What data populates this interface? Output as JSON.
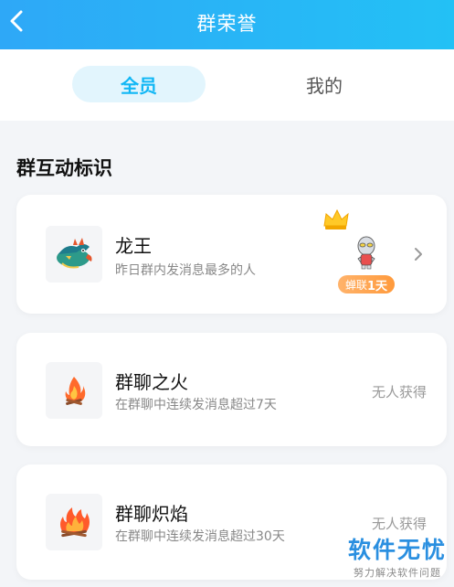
{
  "header": {
    "title": "群荣誉"
  },
  "tabs": [
    {
      "label": "全员",
      "active": true
    },
    {
      "label": "我的",
      "active": false
    }
  ],
  "section": {
    "title": "群互动标识"
  },
  "badges": [
    {
      "name": "龙王",
      "description": "昨日群内发消息最多的人",
      "icon": "dragon-icon",
      "holder_badge": {
        "prefix": "蝉联",
        "days": "1天"
      }
    },
    {
      "name": "群聊之火",
      "description": "在群聊中连续发消息超过7天",
      "icon": "fire-icon",
      "status": "无人获得"
    },
    {
      "name": "群聊炽焰",
      "description": "在群聊中连续发消息超过30天",
      "icon": "blaze-icon",
      "status": "无人获得"
    }
  ],
  "watermark": {
    "brand": "软件无忧",
    "slogan": "努力解决软件问题"
  },
  "colors": {
    "header": "#2ea8f7",
    "accent": "#12b7f5",
    "badge": "#ff9a3c"
  }
}
